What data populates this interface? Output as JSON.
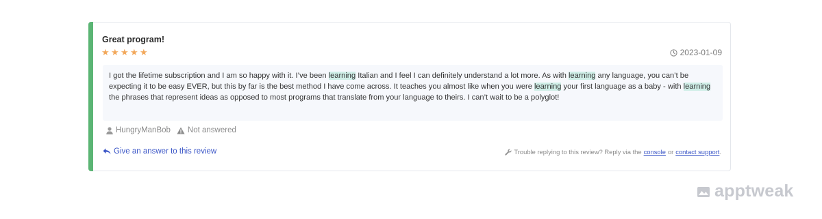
{
  "review": {
    "title": "Great program!",
    "rating": 5,
    "max_rating": 5,
    "date": "2023-01-09",
    "body_segments": [
      {
        "text": "I got the lifetime subscription and I am so happy with it. I’ve been ",
        "highlight": false
      },
      {
        "text": "learning",
        "highlight": true
      },
      {
        "text": " Italian and I feel I can definitely understand a lot more. As with ",
        "highlight": false
      },
      {
        "text": "learning",
        "highlight": true
      },
      {
        "text": " any language, you can’t be expecting it to be easy EVER, but this by far is the best method I have come across. It teaches you almost like when you were ",
        "highlight": false
      },
      {
        "text": "learning",
        "highlight": true
      },
      {
        "text": " your first language as a baby - with ",
        "highlight": false
      },
      {
        "text": "learning",
        "highlight": true
      },
      {
        "text": " the phrases that represent ideas as opposed to most programs that translate from your language to theirs. I can’t wait to be a polyglot!",
        "highlight": false
      }
    ],
    "author": "HungryManBob",
    "status": "Not answered"
  },
  "actions": {
    "answer_label": "Give an answer to this review",
    "trouble_text": "Trouble replying to this review? Reply via the",
    "console_link": "console",
    "or_text": "or",
    "support_link": "contact support",
    "period": "."
  },
  "brand": {
    "logo_text": "apptweak"
  },
  "colors": {
    "accent": "#5bb574",
    "star": "#f2a85b",
    "link": "#3b56c7",
    "highlight": "#cfeee7"
  }
}
